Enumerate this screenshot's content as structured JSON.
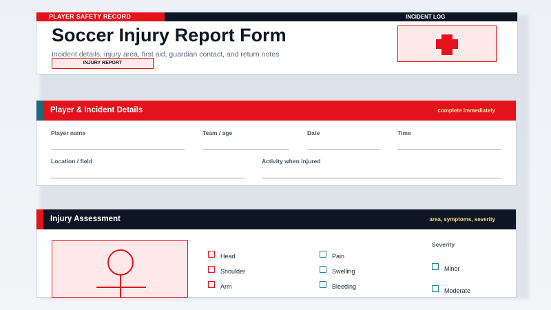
{
  "header": {
    "strip_left": "PLAYER SAFETY RECORD",
    "strip_right": "INCIDENT LOG",
    "title": "Soccer Injury Report Form",
    "subtitle": "Incident details, injury area, first aid, guardian contact, and return notes",
    "badge": "INJURY REPORT",
    "logo_icon": "red-cross-icon"
  },
  "details": {
    "title": "Player & Incident Details",
    "note": "complete immediately",
    "fields": {
      "player_name": "Player name",
      "team_age": "Team / age",
      "date": "Date",
      "time": "Time",
      "location": "Location / field",
      "activity": "Activity when injured"
    }
  },
  "assessment": {
    "title": "Injury Assessment",
    "note": "area, symptoms, severity",
    "body_icon": "body-diagram-icon",
    "areas": [
      "Head",
      "Shoulder",
      "Arm"
    ],
    "symptoms": [
      "Pain",
      "Swelling",
      "Bleeding"
    ],
    "severity_title": "Severity",
    "severity": [
      "Minor",
      "Moderate"
    ]
  },
  "colors": {
    "red": "#e3121c",
    "navy": "#0e1524",
    "teal": "#1b8a8c",
    "pink_fill": "#fde9e9"
  }
}
